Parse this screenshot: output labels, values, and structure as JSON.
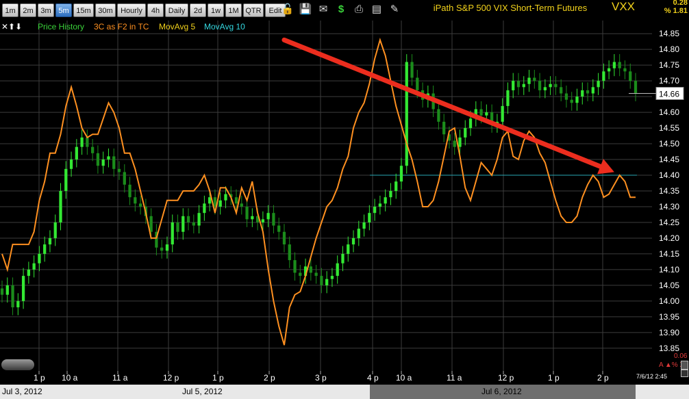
{
  "toolbar": {
    "timeframes": [
      "1m",
      "2m",
      "3m",
      "5m",
      "15m",
      "30m",
      "Hourly",
      "4h",
      "Daily",
      "2d",
      "1w",
      "1M",
      "QTR",
      "Edit"
    ],
    "active": "5m",
    "icons": [
      "lock-icon",
      "save-icon",
      "email-icon",
      "dollar-icon",
      "print-icon",
      "data-window-icon",
      "pencil-icon"
    ]
  },
  "header": {
    "title": "iPath S&P 500 VIX Short-Term Futures",
    "symbol": "VXX",
    "change_value": "0.28",
    "change_pct": "% 1.81"
  },
  "legend": {
    "arrows": "✕⬆⬇",
    "items": [
      {
        "label": "Price History",
        "color": "#3ad23a"
      },
      {
        "label": "3C as F2 in TC",
        "color": "#ff9020"
      },
      {
        "label": "MovAvg 5",
        "color": "#f2d21b"
      },
      {
        "label": "MovAvg 10",
        "color": "#34d8e0"
      }
    ]
  },
  "colors": {
    "price_up": "#33e833",
    "price_down": "#1b8c1b",
    "indicator": "#ff9020",
    "trend_arrow": "#ec2d1e",
    "hline": "#2aa8b4",
    "grid": "#3c3c3c"
  },
  "price_badge": "14.66",
  "footer": {
    "dates": [
      "Jul 3, 2012",
      "Jul 5, 2012",
      "Jul 6, 2012"
    ],
    "timestamp": "7/6/12 2:45",
    "small_value": "0.06",
    "ctrl_label": "A ▲% X"
  },
  "chart_data": {
    "type": "candlestick",
    "y_ticks": [
      "14.85",
      "14.80",
      "14.75",
      "14.70",
      "14.65",
      "14.60",
      "14.55",
      "14.50",
      "14.45",
      "14.40",
      "14.35",
      "14.30",
      "14.25",
      "14.20",
      "14.15",
      "14.10",
      "14.05",
      "14.00",
      "13.95",
      "13.90",
      "13.85"
    ],
    "ylim": [
      13.83,
      14.87
    ],
    "x_ticks": [
      "1 p",
      "10 a",
      "11 a",
      "12 p",
      "1 p",
      "2 p",
      "3 p",
      "4 p",
      "10 a",
      "11 a",
      "12 p",
      "1 p",
      "2 p"
    ],
    "close_series": [
      14.02,
      14.05,
      13.98,
      14.0,
      14.08,
      14.1,
      14.12,
      14.15,
      14.18,
      14.2,
      14.25,
      14.35,
      14.42,
      14.45,
      14.49,
      14.52,
      14.49,
      14.47,
      14.43,
      14.45,
      14.46,
      14.42,
      14.41,
      14.37,
      14.33,
      14.31,
      14.3,
      14.27,
      14.22,
      14.17,
      14.16,
      14.18,
      14.25,
      14.22,
      14.27,
      14.25,
      14.24,
      14.28,
      14.31,
      14.33,
      14.3,
      14.32,
      14.34,
      14.33,
      14.31,
      14.3,
      14.26,
      14.27,
      14.25,
      14.26,
      14.28,
      14.24,
      14.22,
      14.18,
      14.13,
      14.09,
      14.08,
      14.11,
      14.09,
      14.08,
      14.05,
      14.07,
      14.08,
      14.12,
      14.15,
      14.18,
      14.2,
      14.23,
      14.25,
      14.28,
      14.3,
      14.31,
      14.33,
      14.35,
      14.38,
      14.43,
      14.76,
      14.71,
      14.67,
      14.64,
      14.66,
      14.61,
      14.57,
      14.53,
      14.51,
      14.49,
      14.52,
      14.55,
      14.58,
      14.61,
      14.59,
      14.6,
      14.56,
      14.57,
      14.62,
      14.67,
      14.7,
      14.68,
      14.69,
      14.71,
      14.7,
      14.67,
      14.68,
      14.69,
      14.68,
      14.66,
      14.64,
      14.63,
      14.65,
      14.67,
      14.66,
      14.68,
      14.7,
      14.73,
      14.74,
      14.76,
      14.74,
      14.73,
      14.7,
      14.66
    ],
    "indicator_3c": [
      14.15,
      14.1,
      14.18,
      14.18,
      14.18,
      14.18,
      14.22,
      14.32,
      14.38,
      14.47,
      14.47,
      14.53,
      14.62,
      14.68,
      14.62,
      14.55,
      14.52,
      14.53,
      14.53,
      14.58,
      14.63,
      14.6,
      14.55,
      14.47,
      14.47,
      14.42,
      14.35,
      14.28,
      14.2,
      14.2,
      14.26,
      14.32,
      14.32,
      14.32,
      14.35,
      14.35,
      14.35,
      14.37,
      14.4,
      14.35,
      14.28,
      14.36,
      14.36,
      14.33,
      14.28,
      14.36,
      14.32,
      14.38,
      14.28,
      14.22,
      14.1,
      14.0,
      13.92,
      13.86,
      13.98,
      14.02,
      14.03,
      14.08,
      14.14,
      14.2,
      14.25,
      14.3,
      14.32,
      14.36,
      14.42,
      14.46,
      14.55,
      14.6,
      14.63,
      14.69,
      14.77,
      14.83,
      14.78,
      14.7,
      14.62,
      14.56,
      14.5,
      14.45,
      14.38,
      14.3,
      14.3,
      14.32,
      14.38,
      14.46,
      14.54,
      14.55,
      14.46,
      14.36,
      14.32,
      14.38,
      14.44,
      14.42,
      14.4,
      14.45,
      14.52,
      14.54,
      14.46,
      14.45,
      14.51,
      14.54,
      14.52,
      14.47,
      14.44,
      14.38,
      14.32,
      14.27,
      14.25,
      14.25,
      14.27,
      14.33,
      14.37,
      14.4,
      14.38,
      14.33,
      14.34,
      14.37,
      14.4,
      14.38,
      14.33,
      14.33
    ],
    "hline_value": 14.4,
    "trend_arrow": {
      "from": {
        "x_index": 53,
        "y": 14.83
      },
      "to": {
        "x_index": 115,
        "y": 14.41
      }
    }
  }
}
